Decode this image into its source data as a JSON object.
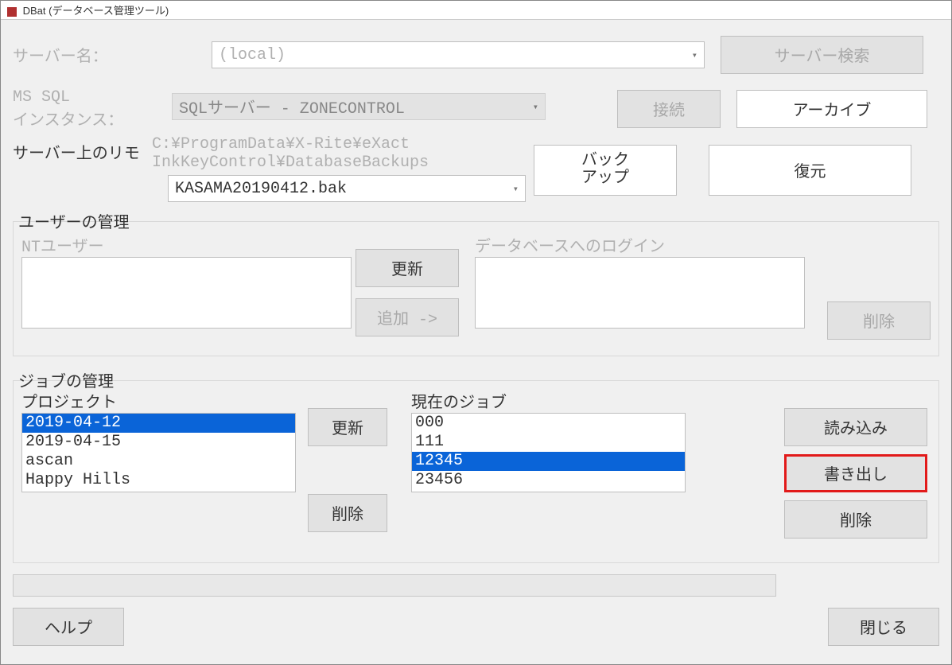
{
  "window": {
    "title": "DBat (データベース管理ツール)"
  },
  "server": {
    "label": "サーバー名：",
    "value": "(local)",
    "search_btn": "サーバー検索"
  },
  "mssql": {
    "label_line1": "MS SQL",
    "label_line2": "インスタンス：",
    "value": "SQLサーバー - ZONECONTROL",
    "connect_btn": "接続",
    "archive_btn": "アーカイブ"
  },
  "remote": {
    "label": "サーバー上のリモ",
    "path_line1": "C:¥ProgramData¥X-Rite¥eXact",
    "path_line2": "InkKeyControl¥DatabaseBackups",
    "file": "KASAMA20190412.bak",
    "backup_btn_line1": "バック",
    "backup_btn_line2": "アップ",
    "restore_btn": "復元"
  },
  "users": {
    "group_label": "ユーザーの管理",
    "nt_label": "NTユーザー",
    "db_login_label": "データベースへのログイン",
    "refresh_btn": "更新",
    "add_btn": "追加 ->",
    "delete_btn": "削除"
  },
  "jobs": {
    "group_label": "ジョブの管理",
    "project_label": "プロジェクト",
    "current_label": "現在のジョブ",
    "projects": [
      "2019-04-12",
      "2019-04-15",
      "ascan",
      "Happy Hills"
    ],
    "project_selected": 0,
    "current_jobs": [
      "000",
      "111",
      "12345",
      "23456"
    ],
    "current_selected": 2,
    "refresh_btn": "更新",
    "delete_proj_btn": "削除",
    "import_btn": "読み込み",
    "export_btn": "書き出し",
    "delete_job_btn": "削除"
  },
  "footer": {
    "help_btn": "ヘルプ",
    "close_btn": "閉じる"
  }
}
